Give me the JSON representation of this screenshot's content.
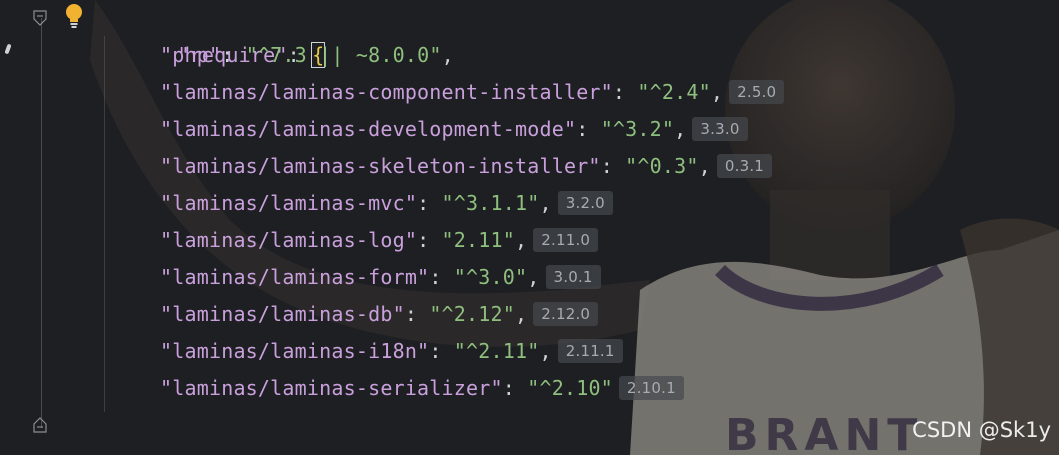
{
  "editor": {
    "header_line": {
      "key": "\"require\"",
      "colon": ": ",
      "brace": "{"
    },
    "entries": [
      {
        "key": "\"php\"",
        "value": "\"^7.3 || ~8.0.0\"",
        "comma": ",",
        "hint": ""
      },
      {
        "key": "\"laminas/laminas-component-installer\"",
        "value": "\"^2.4\"",
        "comma": ",",
        "hint": "2.5.0"
      },
      {
        "key": "\"laminas/laminas-development-mode\"",
        "value": "\"^3.2\"",
        "comma": ",",
        "hint": "3.3.0"
      },
      {
        "key": "\"laminas/laminas-skeleton-installer\"",
        "value": "\"^0.3\"",
        "comma": ",",
        "hint": "0.3.1"
      },
      {
        "key": "\"laminas/laminas-mvc\"",
        "value": "\"^3.1.1\"",
        "comma": ",",
        "hint": "3.2.0"
      },
      {
        "key": "\"laminas/laminas-log\"",
        "value": "\"2.11\"",
        "comma": ",",
        "hint": "2.11.0"
      },
      {
        "key": "\"laminas/laminas-form\"",
        "value": "\"^3.0\"",
        "comma": ",",
        "hint": "3.0.1"
      },
      {
        "key": "\"laminas/laminas-db\"",
        "value": "\"^2.12\"",
        "comma": ",",
        "hint": "2.12.0"
      },
      {
        "key": "\"laminas/laminas-i18n\"",
        "value": "\"^2.11\"",
        "comma": ",",
        "hint": "2.11.1"
      },
      {
        "key": "\"laminas/laminas-serializer\"",
        "value": "\"^2.10\"",
        "comma": "",
        "hint": "2.10.1"
      }
    ],
    "footer_line": {
      "brace": "}",
      "comma": ","
    }
  },
  "icons": {
    "bulb": "lightbulb-icon",
    "fold_top": "fold-icon",
    "fold_bottom": "fold-icon"
  },
  "watermark": "CSDN @Sk1y",
  "colors": {
    "background": "#1e1f22",
    "key": "#c9a0dc",
    "string": "#8fbf7f",
    "brace": "#e8c94a",
    "hint_bg": "#46484d"
  }
}
